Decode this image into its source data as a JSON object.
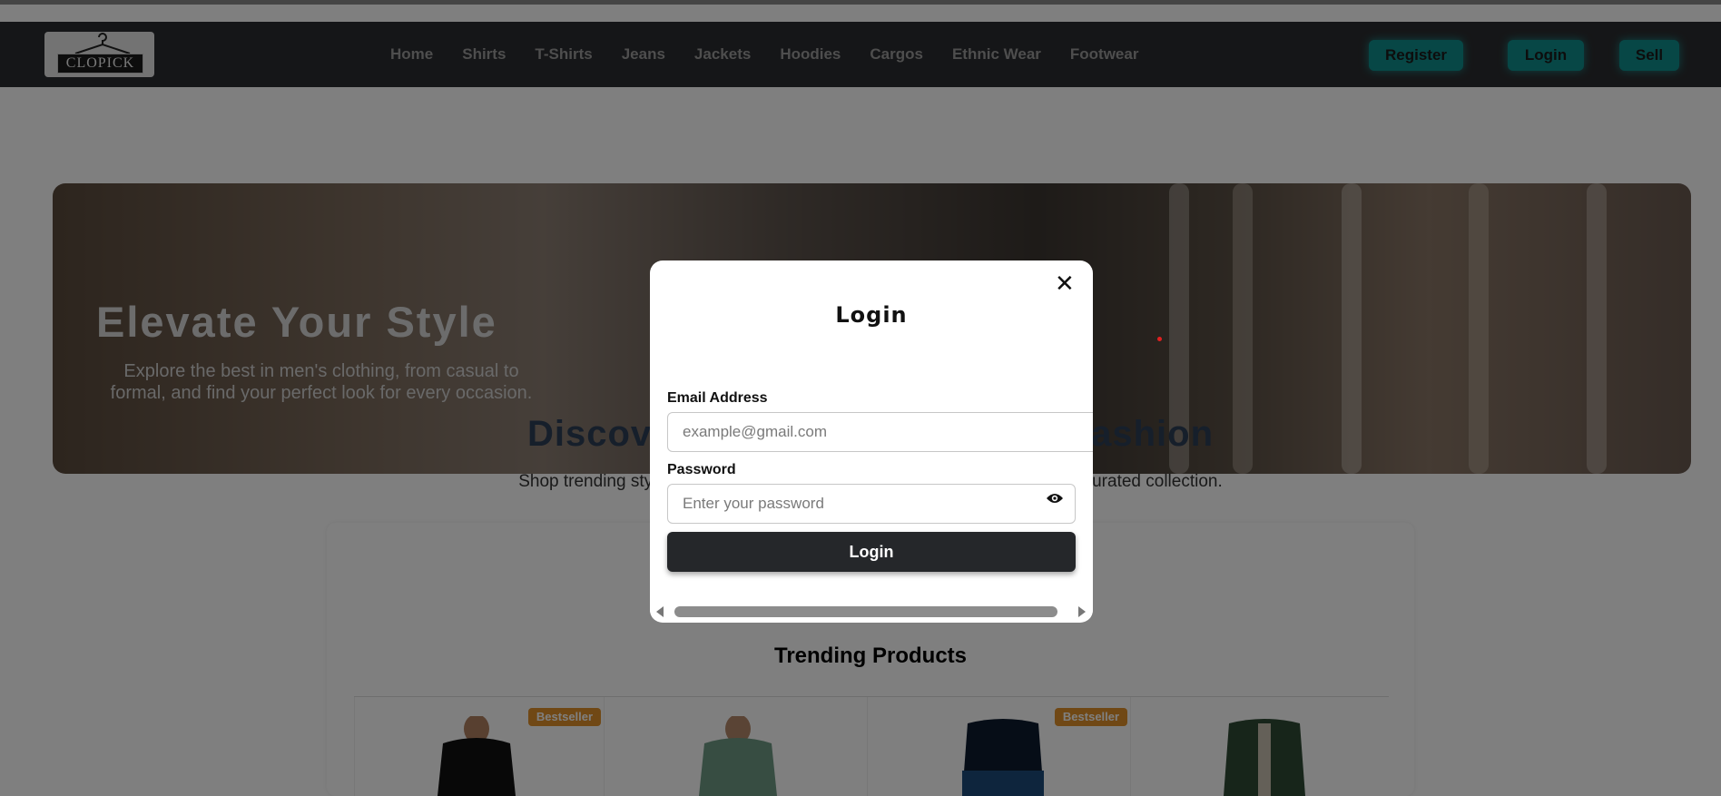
{
  "logo": {
    "text": "CLOPICK"
  },
  "nav": {
    "links": [
      "Home",
      "Shirts",
      "T-Shirts",
      "Jeans",
      "Jackets",
      "Hoodies",
      "Cargos",
      "Ethnic Wear",
      "Footwear"
    ],
    "register_label": "Register",
    "login_label": "Login",
    "sell_label": "Sell"
  },
  "hero": {
    "title": "Elevate Your Style",
    "subtitle": "Explore the best in men's clothing, from casual to formal, and find your perfect look for every occasion."
  },
  "section": {
    "heading_left": "Discov",
    "heading_right": "ashion",
    "sub_left": "Shop trending sty",
    "sub_right": "urated collection."
  },
  "trending": {
    "title": "Trending Products",
    "badges": [
      "Bestseller",
      "Bestseller"
    ]
  },
  "modal": {
    "title": "Login",
    "email_label": "Email Address",
    "email_placeholder": "example@gmail.com",
    "password_label": "Password",
    "password_placeholder": "Enter your password",
    "submit_label": "Login"
  },
  "colors": {
    "navbar": "#2b2d30",
    "accent_teal": "#0f8f8c",
    "badge": "#e0912a",
    "heading": "#2c3e57"
  }
}
